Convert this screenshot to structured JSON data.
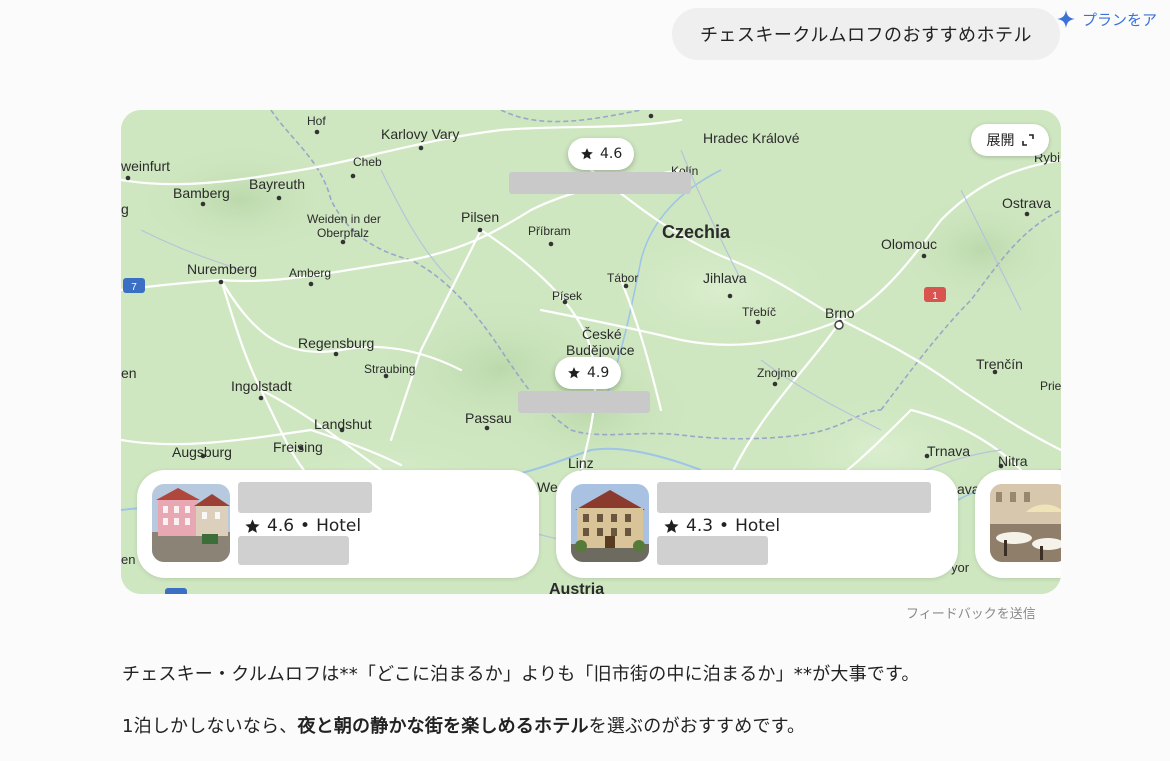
{
  "header": {
    "user_query": "チェスキークルムロフのおすすめホテル",
    "upgrade_label": "プランをア"
  },
  "map": {
    "expand_label": "展開",
    "pins": [
      {
        "rating": "4.6"
      },
      {
        "rating": "4.9"
      }
    ],
    "labels": {
      "hof": "Hof",
      "karlovy_vary": "Karlovy Vary",
      "hradec_kralove": "Hradec Králové",
      "rybnik": "Rybi",
      "schweinfurt": "weinfurt",
      "cheb": "Cheb",
      "kolin": "Kolín",
      "bamberg": "Bamberg",
      "bayreuth": "Bayreuth",
      "g": "g",
      "weiden": "Weiden in der",
      "oberpfalz": "Oberpfalz",
      "pilsen": "Pilsen",
      "pribram": "Příbram",
      "czechia": "Czechia",
      "ostrava": "Ostrava",
      "olomouc": "Olomouc",
      "nuremberg": "Nuremberg",
      "amberg": "Amberg",
      "tabor": "Tábor",
      "jihlava": "Jihlava",
      "pisek": "Písek",
      "trebic": "Třebíč",
      "brno": "Brno",
      "ceske1": "České",
      "ceske2": "Budějovice",
      "regensburg": "Regensburg",
      "straubing": "Straubing",
      "znojmo": "Znojmo",
      "trencin": "Trenčín",
      "en": "en",
      "ingolstadt": "Ingolstadt",
      "prie": "Prie",
      "passau": "Passau",
      "landshut": "Landshut",
      "augsburg": "Augsburg",
      "freising": "Freising",
      "trnava": "Trnava",
      "linz": "Linz",
      "nitra": "Nitra",
      "wels": "We",
      "vava": "ava",
      "austria": "Austria",
      "en2": "en",
      "vyor": "yor",
      "shield7": "7",
      "shield1": "1"
    }
  },
  "hotels": [
    {
      "rating": "4.6",
      "separator": "•",
      "type": "Hotel"
    },
    {
      "rating": "4.3",
      "separator": "•",
      "type": "Hotel"
    }
  ],
  "feedback_label": "フィードバックを送信",
  "response": {
    "p1": "チェスキー・クルムロフは**「どこに泊まるか」よりも「旧市街の中に泊まるか」**が大事です。",
    "p2_before": "1泊しかしないなら、",
    "p2_bold": "夜と朝の静かな街を楽しめるホテル",
    "p2_after": "を選ぶのがおすすめです。"
  },
  "colors": {
    "map_land": "#cfe7c1",
    "road": "#ffffff",
    "accent": "#3a72d8",
    "placeholder": "#d0d0d0"
  },
  "icons": [
    "sparkle-icon",
    "expand-icon",
    "star-icon"
  ]
}
